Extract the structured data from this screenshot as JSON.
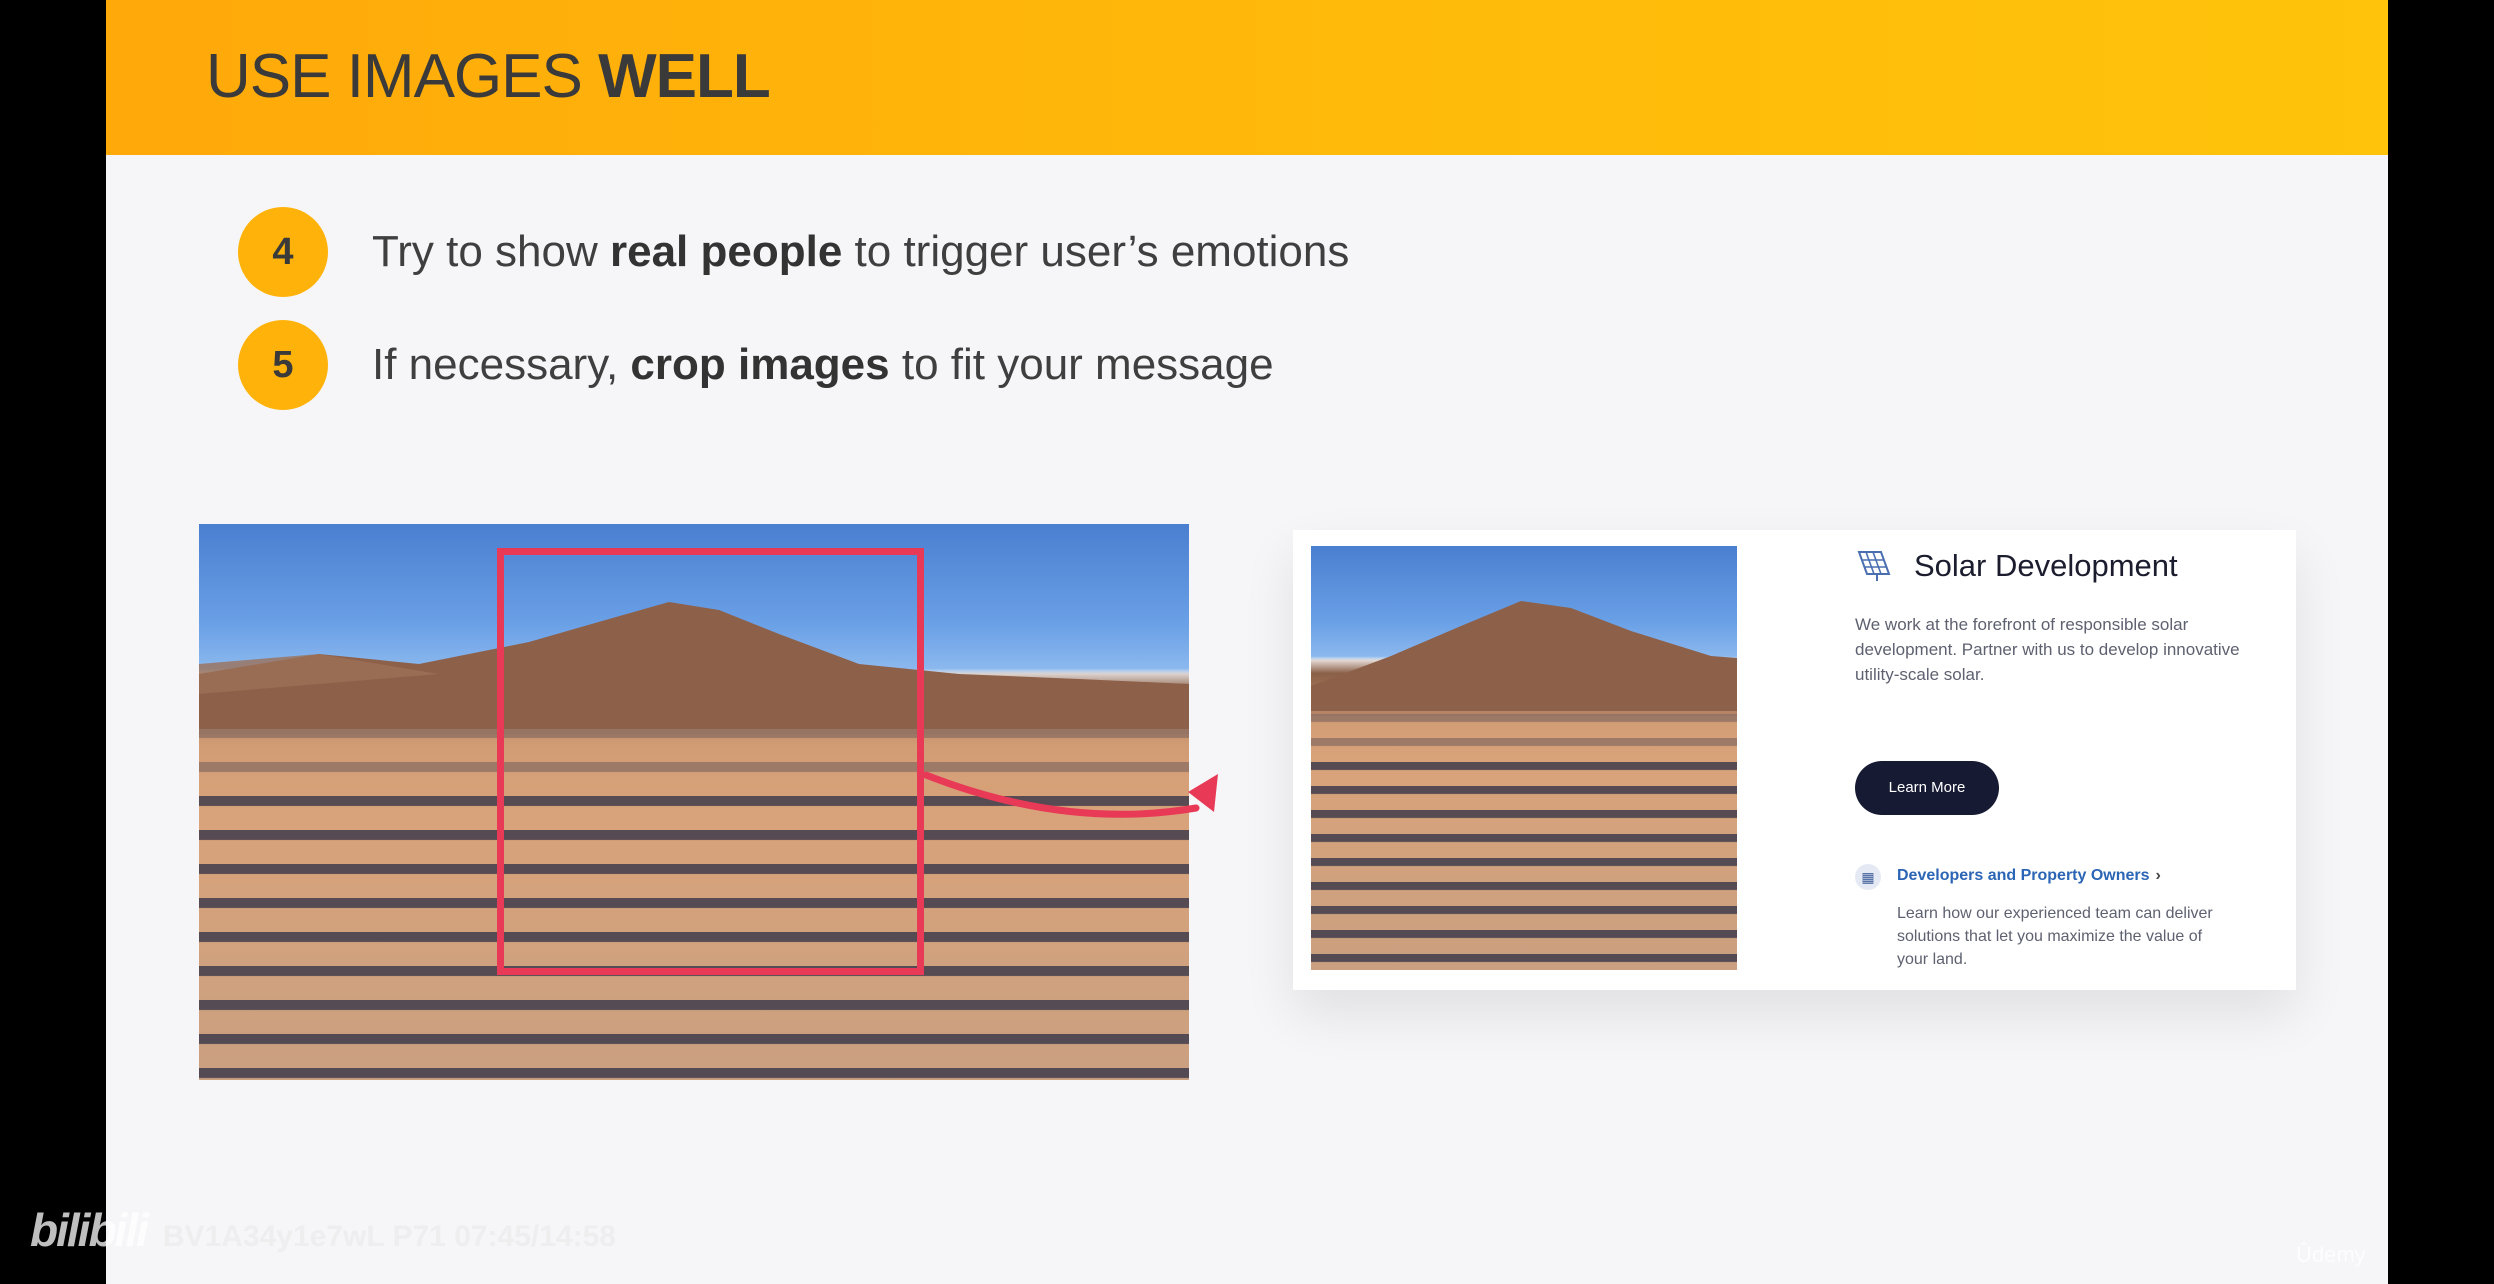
{
  "slide": {
    "title_regular": "USE IMAGES ",
    "title_bold": "WELL",
    "points": [
      {
        "number": "4",
        "text_before": "Try to show ",
        "text_bold": "real people",
        "text_after": " to trigger user’s emotions"
      },
      {
        "number": "5",
        "text_before": "If necessary, ",
        "text_bold": "crop images",
        "text_after": " to fit your message"
      }
    ]
  },
  "card": {
    "heading": "Solar Development",
    "heading_icon": "solar-panel-icon",
    "description": "We work at the forefront of responsible solar development. Partner with us to develop innovative utility-scale solar.",
    "button_label": "Learn More",
    "link_icon": "solar-panel-small-icon",
    "link_label": "Developers and Property Owners",
    "link_chevron": "›",
    "link_description": "Learn how our experienced team can deliver solutions that let you maximize the value of your land."
  },
  "overlay": {
    "watermark_logo": "bilibili",
    "watermark_text": "BV1A34y1e7wL P71 07:45/14:58",
    "udemy": "Ûdemy"
  },
  "colors": {
    "header": "#ffb30a",
    "badge": "#ffb30a",
    "crop_box": "#e83a57",
    "arrow": "#e83a57",
    "button": "#171a33",
    "link": "#2b65b5"
  }
}
